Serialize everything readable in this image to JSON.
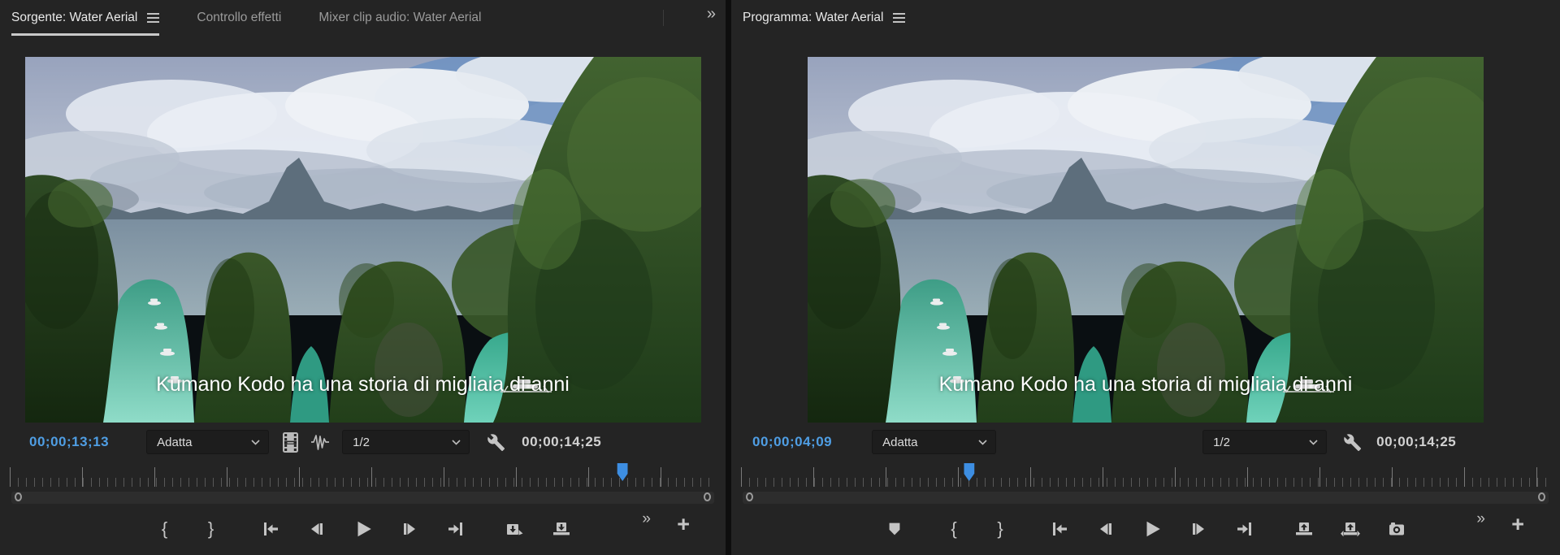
{
  "colors": {
    "panel_bg": "#242424",
    "panel_divider": "#0e0e0e",
    "timecode_blue": "#4f9ee4",
    "playhead_blue": "#3d8ee2",
    "active_tab_underline": "#c9c9c9",
    "icon_gray": "#c4c4c4",
    "lagoon_turquoise": "#57c7ae"
  },
  "glyphs": {
    "mark_in": "{",
    "mark_out": "}",
    "more": "»",
    "add": "+"
  },
  "source_monitor": {
    "tabs": [
      {
        "label": "Sorgente: Water Aerial",
        "active": true
      },
      {
        "label": "Controllo effetti",
        "active": false
      },
      {
        "label": "Mixer clip audio: Water Aerial",
        "active": false
      }
    ],
    "video": {
      "subtitle": "Kumano Kodo ha una storia di migliaia di anni"
    },
    "controls": {
      "current_timecode": "00;00;13;13",
      "zoom_fit": "Adatta",
      "playback_resolution": "1/2",
      "duration": "00;00;14;25"
    },
    "playhead_pct": 85.8
  },
  "program_monitor": {
    "tab": "Programma: Water Aerial",
    "video": {
      "subtitle": "Kumano Kodo ha una storia di migliaia di anni"
    },
    "controls": {
      "current_timecode": "00;00;04;09",
      "zoom_fit": "Adatta",
      "playback_resolution": "1/2",
      "duration": "00;00;14;25"
    },
    "playhead_pct": 28.7
  }
}
